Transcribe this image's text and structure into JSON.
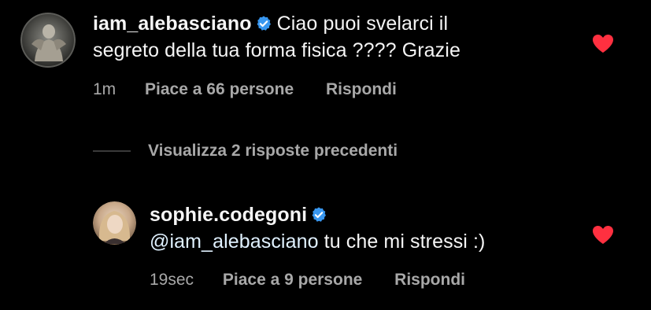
{
  "comments": [
    {
      "username": "iam_alebasciano",
      "text_line1": "Ciao puoi svelarci il",
      "text_line2": "segreto della tua forma fisica ???? Grazie",
      "time": "1m",
      "likes": "Piace a 66 persone",
      "reply": "Rispondi",
      "liked": true,
      "verified": true
    }
  ],
  "view_replies": {
    "label": "Visualizza 2 risposte precedenti"
  },
  "replies": [
    {
      "username": "sophie.codegoni",
      "mention": "@iam_alebasciano",
      "text": " tu che mi stressi :)",
      "time": "19sec",
      "likes": "Piace a 9 persone",
      "reply": "Rispondi",
      "liked": true,
      "verified": true
    }
  ],
  "colors": {
    "background": "#000000",
    "text": "#f5f5f5",
    "secondary_text": "#a8a8a8",
    "heart": "#ff3040",
    "verified": "#3897f0"
  },
  "icons": {
    "verified": "verified-badge-icon",
    "heart": "heart-filled-icon"
  }
}
